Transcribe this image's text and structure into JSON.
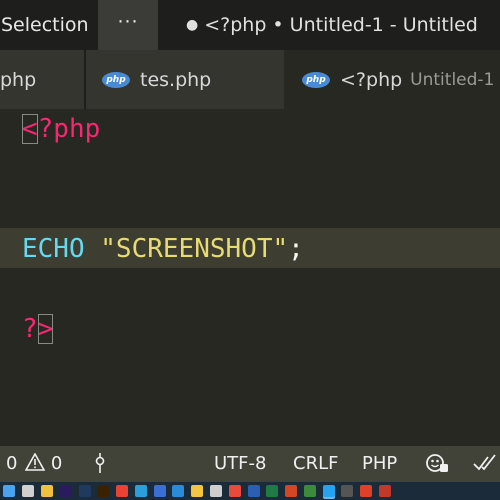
{
  "titlebar": {
    "menu_selection": "Selection",
    "menu_more": "···",
    "modified_dot": "●",
    "window_title": "<?php • Untitled-1 - Untitled"
  },
  "tabs": [
    {
      "label": "php",
      "icon": "php-file-icon"
    },
    {
      "label": "tes.php",
      "icon": "php-file-icon",
      "icon_text": "php"
    },
    {
      "label": "<?php",
      "description": "Untitled-1",
      "icon": "php-file-icon",
      "icon_text": "php"
    }
  ],
  "editor": {
    "line1": {
      "open_bracket": "<",
      "rest": "?php"
    },
    "line2": {
      "keyword": "ECHO",
      "space": " ",
      "string": "\"SCREENSHOT\"",
      "semicolon": ";"
    },
    "line3": {
      "question": "?",
      "close_bracket": ">"
    }
  },
  "statusbar": {
    "errors_count": "0",
    "warnings_count": "0",
    "encoding": "UTF-8",
    "eol": "CRLF",
    "language": "PHP"
  },
  "taskbar": {
    "icons": [
      {
        "name": "windows-start-icon",
        "color": "#4aa3f0"
      },
      {
        "name": "search-icon",
        "color": "#d0d0d0"
      },
      {
        "name": "file-explorer-icon",
        "color": "#f0c040"
      },
      {
        "name": "premiere-icon",
        "color": "#2a1a5e"
      },
      {
        "name": "photoshop-icon",
        "color": "#1f3a5e"
      },
      {
        "name": "illustrator-icon",
        "color": "#3a2200"
      },
      {
        "name": "chrome-icon",
        "color": "#e94235"
      },
      {
        "name": "edge-icon",
        "color": "#2b9fd9"
      },
      {
        "name": "settings-icon",
        "color": "#3c6fd6"
      },
      {
        "name": "app-l-icon",
        "color": "#2b8bd9"
      },
      {
        "name": "camera-icon",
        "color": "#f4c542"
      },
      {
        "name": "app-circle-icon",
        "color": "#cfcfcf"
      },
      {
        "name": "browser-icon",
        "color": "#e84a3c"
      },
      {
        "name": "word-icon",
        "color": "#2b5fb4"
      },
      {
        "name": "excel-icon",
        "color": "#1f7a45"
      },
      {
        "name": "powerpoint-icon",
        "color": "#d24726"
      },
      {
        "name": "app-g-icon",
        "color": "#3c8a3c"
      },
      {
        "name": "vscode-icon",
        "color": "#23a3f0"
      },
      {
        "name": "app-x-icon",
        "color": "#555555"
      },
      {
        "name": "app-red-icon",
        "color": "#e0402a"
      },
      {
        "name": "app-book-icon",
        "color": "#c0392b"
      }
    ]
  },
  "colors": {
    "background": "#272822",
    "tag": "#f92672",
    "keyword": "#66d9ef",
    "string": "#e6db74",
    "statusbar": "#414339"
  }
}
